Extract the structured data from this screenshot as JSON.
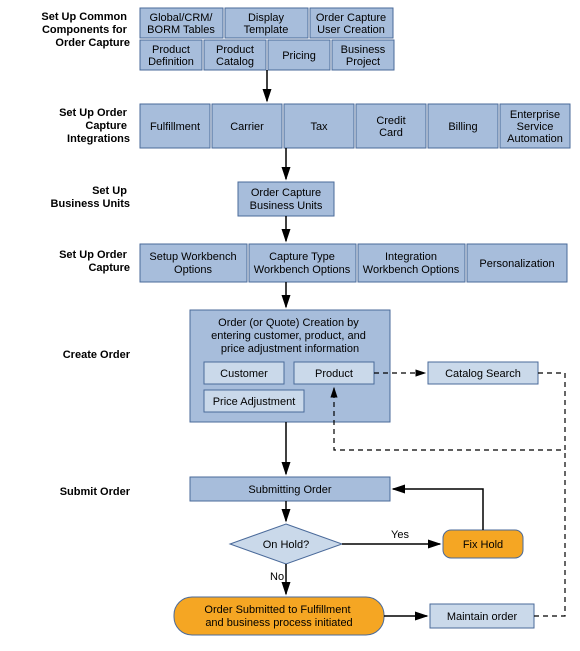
{
  "labels": {
    "l1a": "Set Up Common",
    "l1b": "Components for",
    "l1c": "Order Capture",
    "l2a": "Set Up Order",
    "l2b": "Capture",
    "l2c": "Integrations",
    "l3a": "Set Up",
    "l3b": "Business Units",
    "l4a": "Set Up Order",
    "l4b": "Capture",
    "l5": "Create Order",
    "l6": "Submit Order"
  },
  "r1": {
    "c1a": "Global/CRM/",
    "c1b": "BORM Tables",
    "c2a": "Display",
    "c2b": "Template",
    "c3a": "Order Capture",
    "c3b": "User Creation",
    "c4a": "Product",
    "c4b": "Definition",
    "c5a": "Product",
    "c5b": "Catalog",
    "c6": "Pricing",
    "c7a": "Business",
    "c7b": "Project"
  },
  "r2": {
    "c1": "Fulfillment",
    "c2": "Carrier",
    "c3": "Tax",
    "c4a": "Credit",
    "c4b": "Card",
    "c5": "Billing",
    "c6a": "Enterprise",
    "c6b": "Service",
    "c6c": "Automation"
  },
  "r3": {
    "c1a": "Order Capture",
    "c1b": "Business Units"
  },
  "r4": {
    "c1a": "Setup Workbench",
    "c1b": "Options",
    "c2a": "Capture Type",
    "c2b": "Workbench Options",
    "c3a": "Integration",
    "c3b": "Workbench Options",
    "c4": "Personalization"
  },
  "create": {
    "h1": "Order (or Quote) Creation by",
    "h2": "entering customer, product, and",
    "h3": "price adjustment information",
    "b1": "Customer",
    "b2": "Product",
    "b3": "Price Adjustment"
  },
  "catalog": "Catalog Search",
  "submit": "Submitting Order",
  "onhold": "On Hold?",
  "yes": "Yes",
  "no": "No",
  "fixhold": "Fix Hold",
  "submitted1": "Order Submitted to Fulfillment",
  "submitted2": "and business process initiated",
  "maintain": "Maintain order"
}
